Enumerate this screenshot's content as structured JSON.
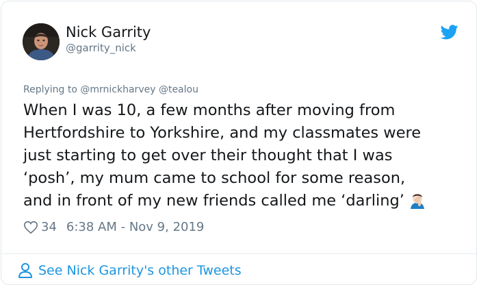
{
  "user": {
    "display_name": "Nick Garrity",
    "handle": "@garrity_nick",
    "avatar_icon": "avatar-photo"
  },
  "reply": {
    "prefix": "Replying to",
    "mentions": [
      "@mrnickharvey",
      "@tealou"
    ]
  },
  "tweet": {
    "lines": [
      "When I was 10, a few months after moving from",
      "Hertfordshire to Yorkshire, and my classmates were",
      "just starting to get over their thought that I was",
      "‘posh’, my mum came to school for some reason,",
      "and in front of my new friends called me ‘darling’"
    ],
    "emoji_icon": "man-facepalming-emoji"
  },
  "meta": {
    "likes": "34",
    "timestamp": "6:38 AM - Nov 9, 2019",
    "like_icon": "heart-icon"
  },
  "footer": {
    "see_more_label": "See Nick Garrity's other Tweets",
    "icon": "person-icon"
  },
  "colors": {
    "twitter_blue": "#1da1f2",
    "link_blue": "#1b95e0",
    "text": "#14171a",
    "muted": "#657786"
  }
}
